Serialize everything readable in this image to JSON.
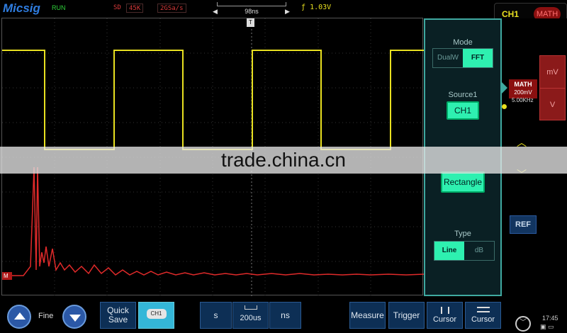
{
  "header": {
    "brand": "Micsig",
    "run_state": "RUN",
    "sd": "SD",
    "memory_depth": "45K",
    "sample_rate": "2GSa/s",
    "timebase": "98ns",
    "trigger": "1.03V"
  },
  "channel_selector": {
    "ch1": "CH1",
    "math": "MATH"
  },
  "panel": {
    "mode_label": "Mode",
    "mode_options": [
      "DualW",
      "FFT"
    ],
    "source_label": "Source1",
    "source_value": "CH1",
    "window_value": "Rectangle",
    "type_label": "Type",
    "type_options": [
      "Line",
      "dB"
    ]
  },
  "right_rail": {
    "math_badge": "MATH",
    "math_scale": "200mV",
    "math_freq": "5.00KHz",
    "unit_up": "mV",
    "unit_down": "V",
    "ref": "REF"
  },
  "bottom": {
    "fine": "Fine",
    "quick_save": "Quick\nSave",
    "ch1": "CH1",
    "s": "s",
    "timebase_value": "200us",
    "ns": "ns",
    "measure": "Measure",
    "trigger": "Trigger",
    "cursor1": "Cursor",
    "cursor2": "Cursor",
    "clock": "17:45"
  },
  "markers": {
    "math_marker": "M",
    "trigger_marker": "T"
  },
  "watermark": "trade.china.cn",
  "colors": {
    "ch1": "#e8e020",
    "math": "#e02a2a",
    "accent": "#2ef0b0",
    "panel_border": "#3fa9a0"
  }
}
